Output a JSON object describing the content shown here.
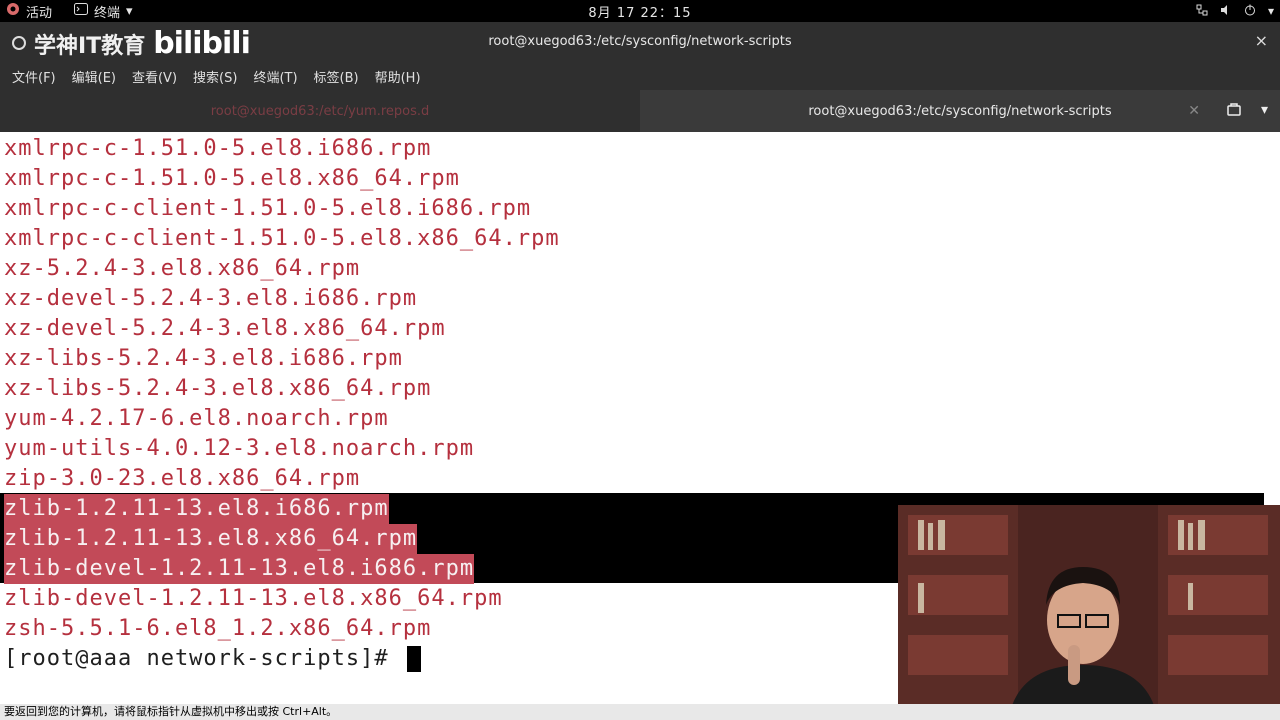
{
  "topbar": {
    "activities_label": "活动",
    "app_label": "终端",
    "clock": "8月 17  22：15"
  },
  "window": {
    "brand_text": "学神IT教育",
    "brand_logo": "bilibili",
    "title": "root@xuegod63:/etc/sysconfig/network-scripts",
    "close_label": "×"
  },
  "menu": [
    {
      "label": "文件(F)"
    },
    {
      "label": "编辑(E)"
    },
    {
      "label": "查看(V)"
    },
    {
      "label": "搜索(S)"
    },
    {
      "label": "终端(T)"
    },
    {
      "label": "标签(B)"
    },
    {
      "label": "帮助(H)"
    }
  ],
  "tabs": [
    {
      "label": "root@xuegod63:/etc/yum.repos.d",
      "state": "inactive"
    },
    {
      "label": "root@xuegod63:/etc/sysconfig/network-scripts",
      "state": "active"
    }
  ],
  "terminal": {
    "lines": [
      "xmlrpc-c-1.51.0-5.el8.i686.rpm",
      "xmlrpc-c-1.51.0-5.el8.x86_64.rpm",
      "xmlrpc-c-client-1.51.0-5.el8.i686.rpm",
      "xmlrpc-c-client-1.51.0-5.el8.x86_64.rpm",
      "xz-5.2.4-3.el8.x86_64.rpm",
      "xz-devel-5.2.4-3.el8.i686.rpm",
      "xz-devel-5.2.4-3.el8.x86_64.rpm",
      "xz-libs-5.2.4-3.el8.i686.rpm",
      "xz-libs-5.2.4-3.el8.x86_64.rpm",
      "yum-4.2.17-6.el8.noarch.rpm",
      "yum-utils-4.0.12-3.el8.noarch.rpm",
      "zip-3.0-23.el8.x86_64.rpm",
      "zlib-1.2.11-13.el8.i686.rpm",
      "zlib-1.2.11-13.el8.x86_64.rpm",
      "zlib-devel-1.2.11-13.el8.i686.rpm",
      "zlib-devel-1.2.11-13.el8.x86_64.rpm",
      "zsh-5.5.1-6.el8_1.2.x86_64.rpm"
    ],
    "prompt": "[root@aaa network-scripts]# "
  },
  "status_bar": "要返回到您的计算机，请将鼠标指针从虚拟机中移出或按 Ctrl+Alt。",
  "colors": {
    "terminal_text": "#b5303e",
    "selection_bg": "#c24a58",
    "terminal_bg": "#ffffff"
  }
}
